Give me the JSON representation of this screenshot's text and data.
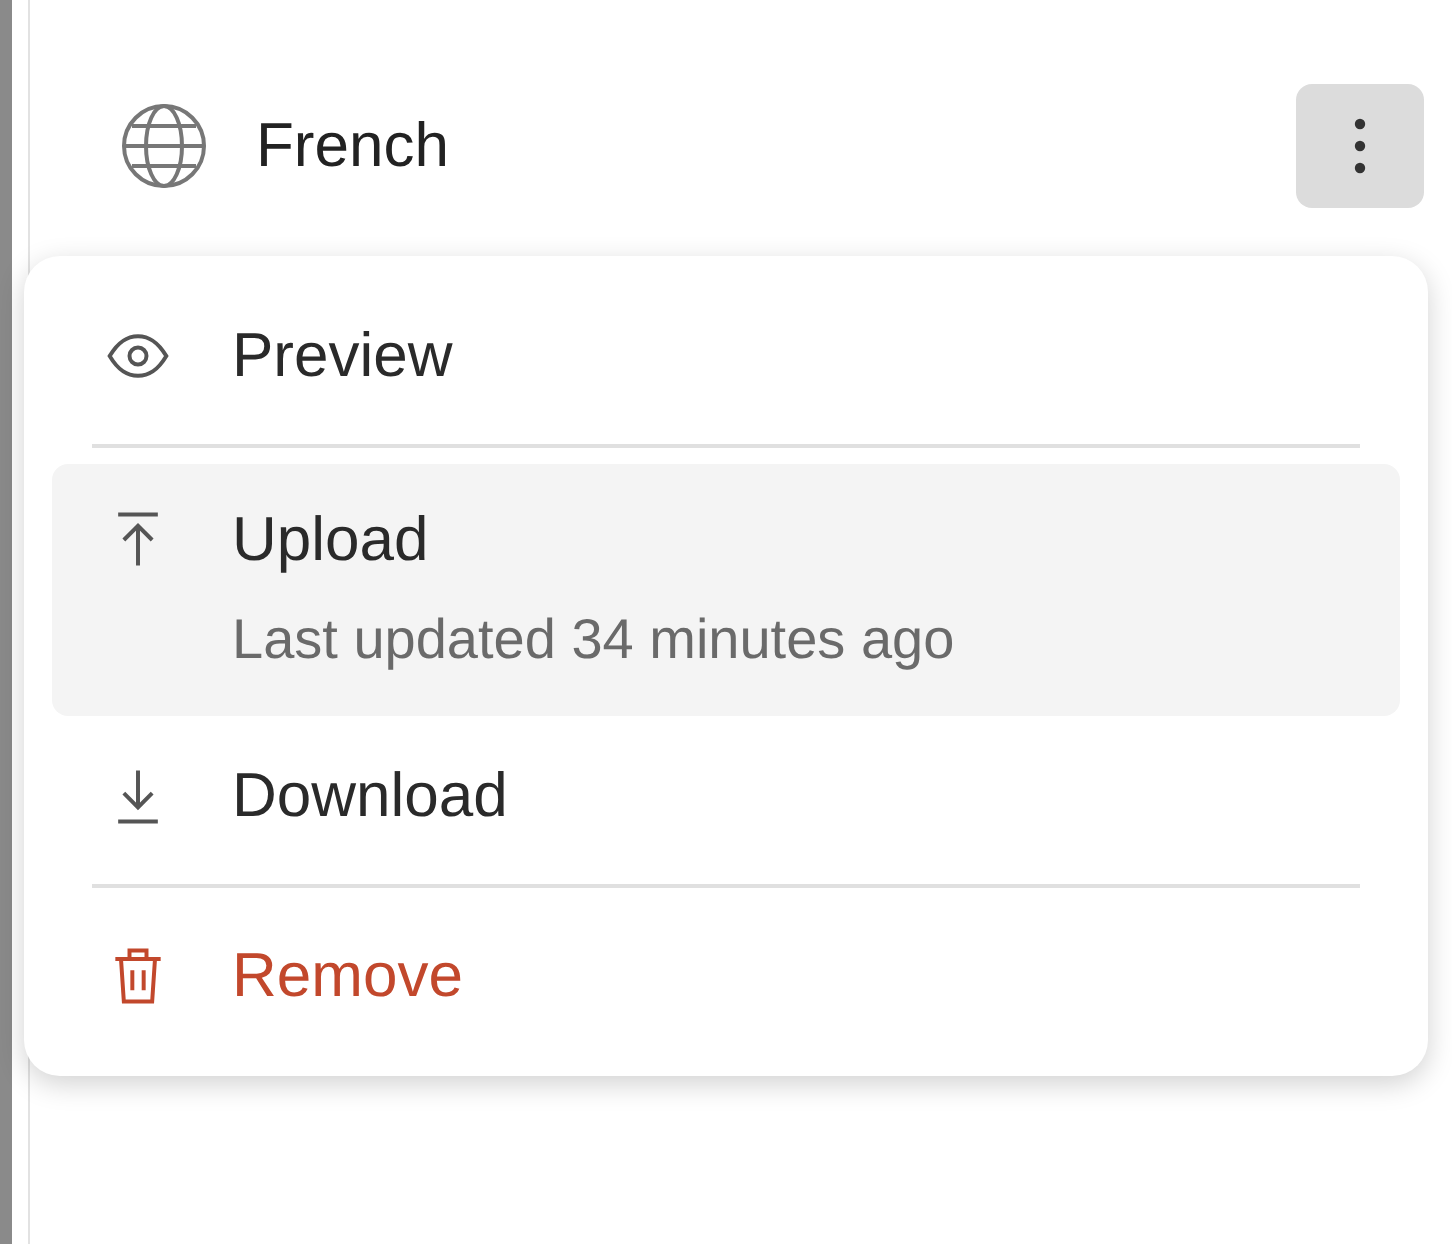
{
  "language": {
    "name": "French"
  },
  "menu": {
    "items": [
      {
        "kind": "preview",
        "label": "Preview",
        "selected": false
      },
      {
        "kind": "divider"
      },
      {
        "kind": "upload",
        "label": "Upload",
        "note": "Last updated 34 minutes ago",
        "selected": true
      },
      {
        "kind": "download",
        "label": "Download",
        "selected": false
      },
      {
        "kind": "divider"
      },
      {
        "kind": "remove",
        "label": "Remove",
        "selected": false
      }
    ]
  }
}
